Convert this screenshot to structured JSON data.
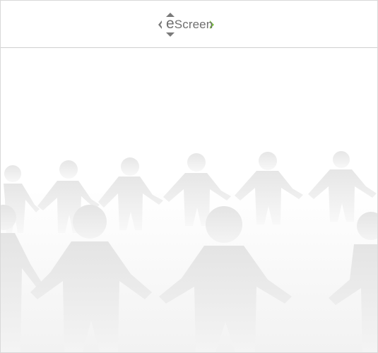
{
  "header": {
    "logo": {
      "prefix": "e",
      "rest": "Screen",
      "icon_left": "chevron-left-icon",
      "icon_right": "chevron-right-icon",
      "accent_color": "#7cc242",
      "text_color": "#6f6f6f"
    }
  },
  "main": {
    "illustration": "paper-people-chain-illustration",
    "background_color": "#ffffff",
    "figure_color": "#e4e4e4"
  }
}
